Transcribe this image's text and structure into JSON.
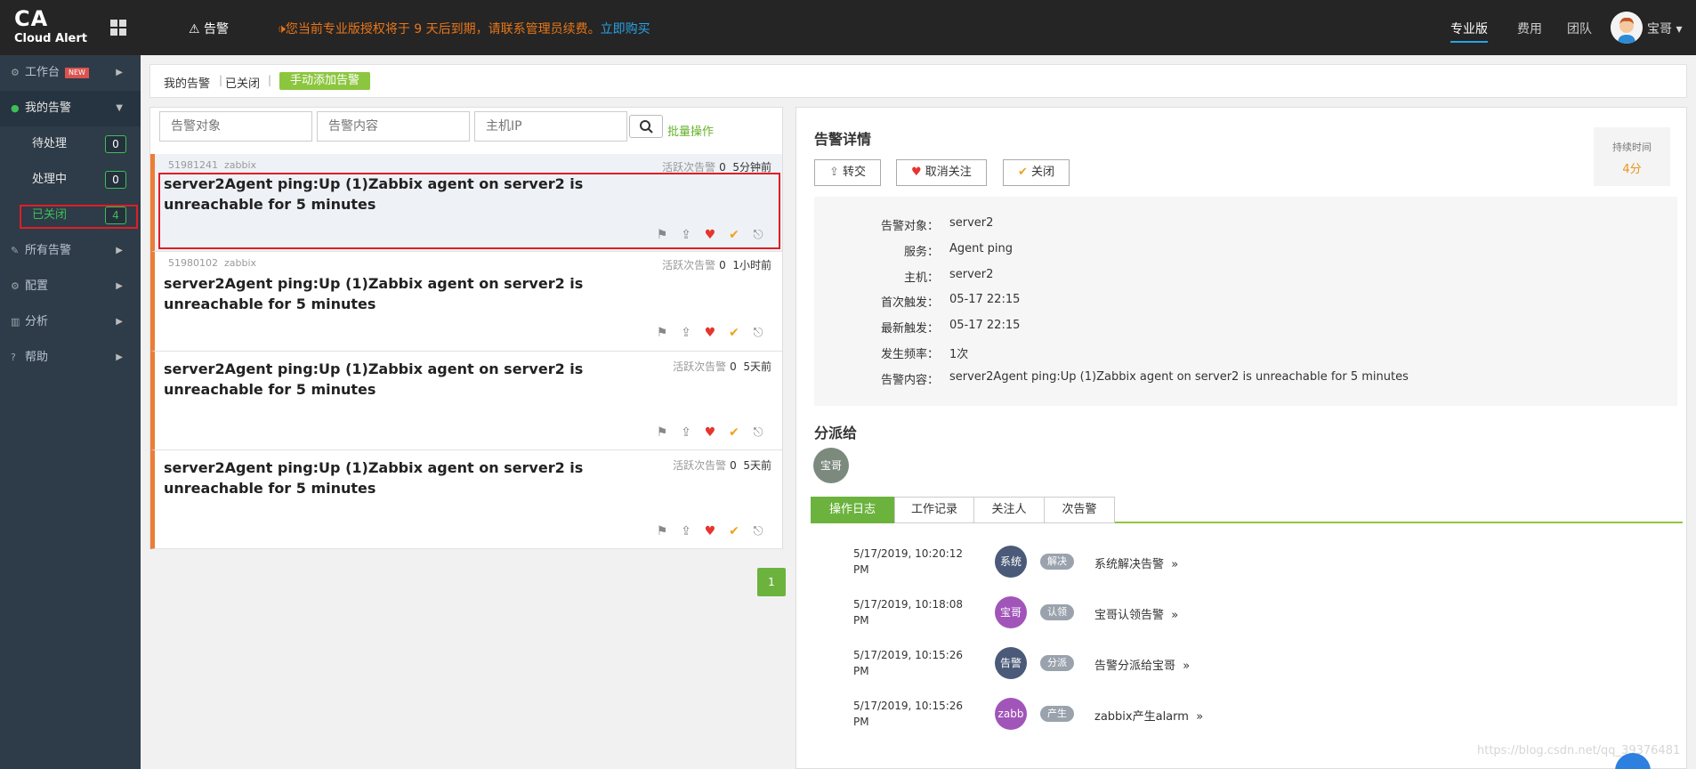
{
  "header": {
    "logo_main": "CA",
    "logo_sub": "Cloud Alert",
    "nav_alarm": "告警",
    "notice": "您当前专业版授权将于 9 天后到期，请联系管理员续费。",
    "notice_link": "立即购买",
    "nav": [
      "专业版",
      "费用",
      "团队"
    ],
    "user": "宝哥"
  },
  "sidebar": {
    "workbench": "工作台",
    "new_badge": "NEW",
    "my_alerts": "我的告警",
    "sub": [
      {
        "label": "待处理",
        "count": "0"
      },
      {
        "label": "处理中",
        "count": "0"
      },
      {
        "label": "已关闭",
        "count": "4"
      }
    ],
    "all_alerts": "所有告警",
    "config": "配置",
    "analysis": "分析",
    "help": "帮助"
  },
  "filterbar": {
    "tab_mine": "我的告警",
    "tab_closed": "已关闭",
    "add_button": "手动添加告警"
  },
  "search": {
    "placeholder_target": "告警对象",
    "placeholder_content": "告警内容",
    "placeholder_ip": "主机IP",
    "batch": "批量操作"
  },
  "alerts": [
    {
      "id": "51981241",
      "source": "zabbix",
      "title": "server2Agent ping:Up (1)Zabbix agent on server2 is unreachable for 5 minutes",
      "stat_label": "活跃次告警",
      "stat_count": "0",
      "time": "5分钟前"
    },
    {
      "id": "51980102",
      "source": "zabbix",
      "title": "server2Agent ping:Up (1)Zabbix agent on server2 is unreachable for 5 minutes",
      "stat_label": "活跃次告警",
      "stat_count": "0",
      "time": "1小时前"
    },
    {
      "id": "",
      "source": "",
      "title": "server2Agent ping:Up (1)Zabbix agent on server2 is unreachable for 5 minutes",
      "stat_label": "活跃次告警",
      "stat_count": "0",
      "time": "5天前"
    },
    {
      "id": "",
      "source": "",
      "title": "server2Agent ping:Up (1)Zabbix agent on server2 is unreachable for 5 minutes",
      "stat_label": "活跃次告警",
      "stat_count": "0",
      "time": "5天前"
    }
  ],
  "pager": {
    "current": "1"
  },
  "detail": {
    "title": "告警详情",
    "buttons": [
      "转交",
      "取消关注",
      "关闭"
    ],
    "duration_label": "持续时间",
    "duration_value": "4分",
    "fields": [
      {
        "k": "告警对象：",
        "v": "server2"
      },
      {
        "k": "服务：",
        "v": "Agent ping"
      },
      {
        "k": "主机：",
        "v": "server2"
      },
      {
        "k": "首次触发：",
        "v": "05-17 22:15"
      },
      {
        "k": "最新触发：",
        "v": "05-17 22:15"
      },
      {
        "k": "发生频率：",
        "v": "1次"
      },
      {
        "k": "告警内容：",
        "v": "server2Agent ping:Up (1)Zabbix agent on server2 is unreachable for 5 minutes"
      }
    ],
    "assign_title": "分派给",
    "assignee": "宝哥",
    "tabs": [
      "操作日志",
      "工作记录",
      "关注人",
      "次告警"
    ],
    "logs": [
      {
        "time1": "5/17/2019, 10:20:12",
        "time2": "PM",
        "who": "系统",
        "tag": "解决",
        "msg": "系统解决告警",
        "color": "#4a5a78"
      },
      {
        "time1": "5/17/2019, 10:18:08",
        "time2": "PM",
        "who": "宝哥",
        "tag": "认领",
        "msg": "宝哥认领告警",
        "color": "#a155b9"
      },
      {
        "time1": "5/17/2019, 10:15:26",
        "time2": "PM",
        "who": "告警",
        "tag": "分派",
        "msg": "告警分派给宝哥",
        "color": "#4a5a78"
      },
      {
        "time1": "5/17/2019, 10:15:26",
        "time2": "PM",
        "who": "zabb",
        "tag": "产生",
        "msg": "zabbix产生alarm",
        "color": "#a155b9"
      }
    ]
  },
  "watermark": "https://blog.csdn.net/qq_39376481"
}
